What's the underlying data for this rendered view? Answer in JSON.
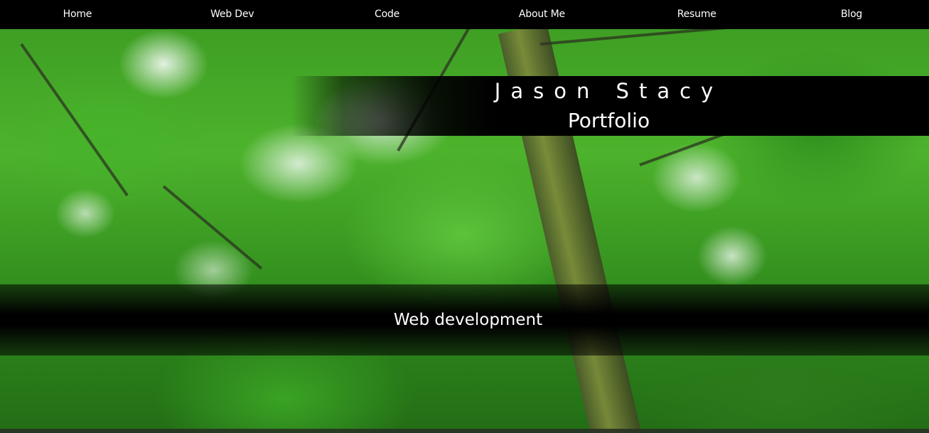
{
  "nav": {
    "items": [
      {
        "label": "Home"
      },
      {
        "label": "Web Dev"
      },
      {
        "label": "Code"
      },
      {
        "label": "About Me"
      },
      {
        "label": "Resume"
      },
      {
        "label": "Blog"
      }
    ]
  },
  "header": {
    "name": "Jason Stacy",
    "subtitle": "Portfolio"
  },
  "section": {
    "heading": "Web development"
  },
  "colors": {
    "nav_background": "#000000",
    "text": "#ffffff",
    "foliage": "#46b22a"
  }
}
